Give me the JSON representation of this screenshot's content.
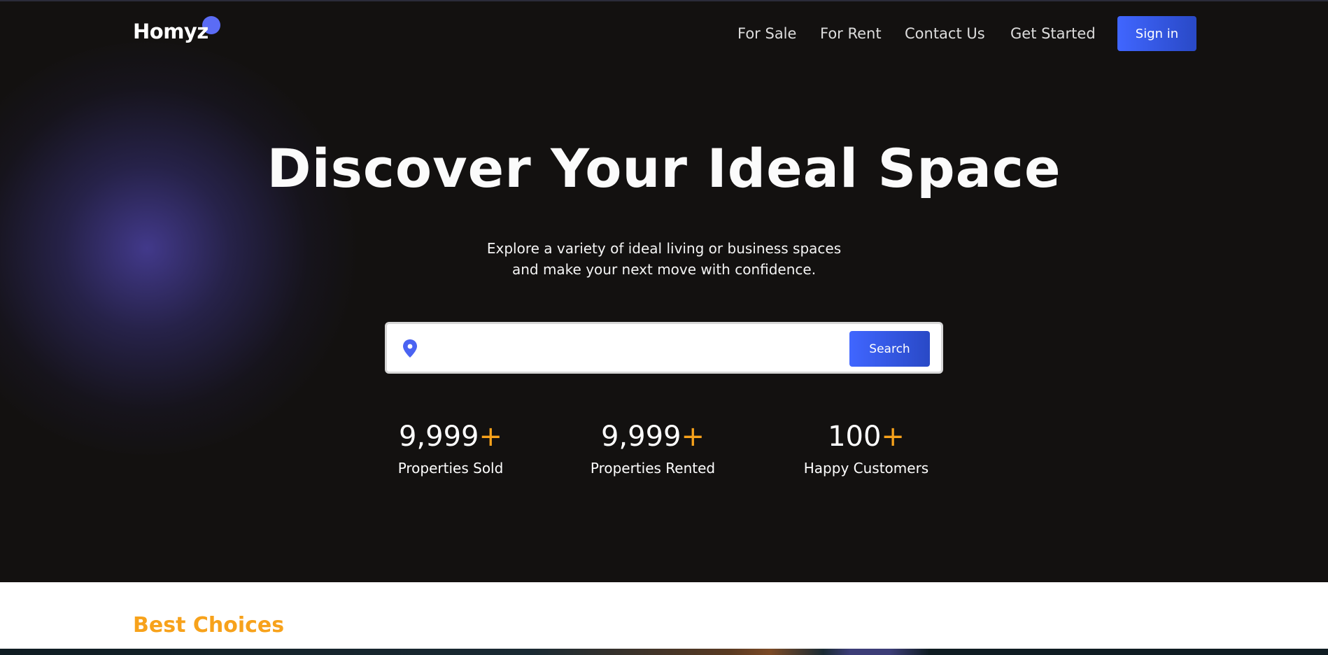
{
  "brand": {
    "name": "Homyz",
    "accent_color": "#5b6cf5",
    "highlight_color": "#f7a21b"
  },
  "nav": {
    "items": [
      {
        "label": "For Sale"
      },
      {
        "label": "For Rent"
      },
      {
        "label": "Contact Us"
      },
      {
        "label": "Get Started"
      }
    ],
    "signin_label": "Sign in"
  },
  "hero": {
    "title": "Discover Your Ideal Space",
    "subtitle_line1": "Explore a variety of ideal living or business spaces",
    "subtitle_line2": "and make your next move with confidence."
  },
  "search": {
    "placeholder": "",
    "value": "",
    "icon": "location-pin-icon",
    "button_label": "Search"
  },
  "stats": [
    {
      "value": "9,999",
      "suffix": "+",
      "label": "Properties Sold"
    },
    {
      "value": "9,999",
      "suffix": "+",
      "label": "Properties Rented"
    },
    {
      "value": "100",
      "suffix": "+",
      "label": "Happy Customers"
    }
  ],
  "section": {
    "title": "Best Choices"
  }
}
